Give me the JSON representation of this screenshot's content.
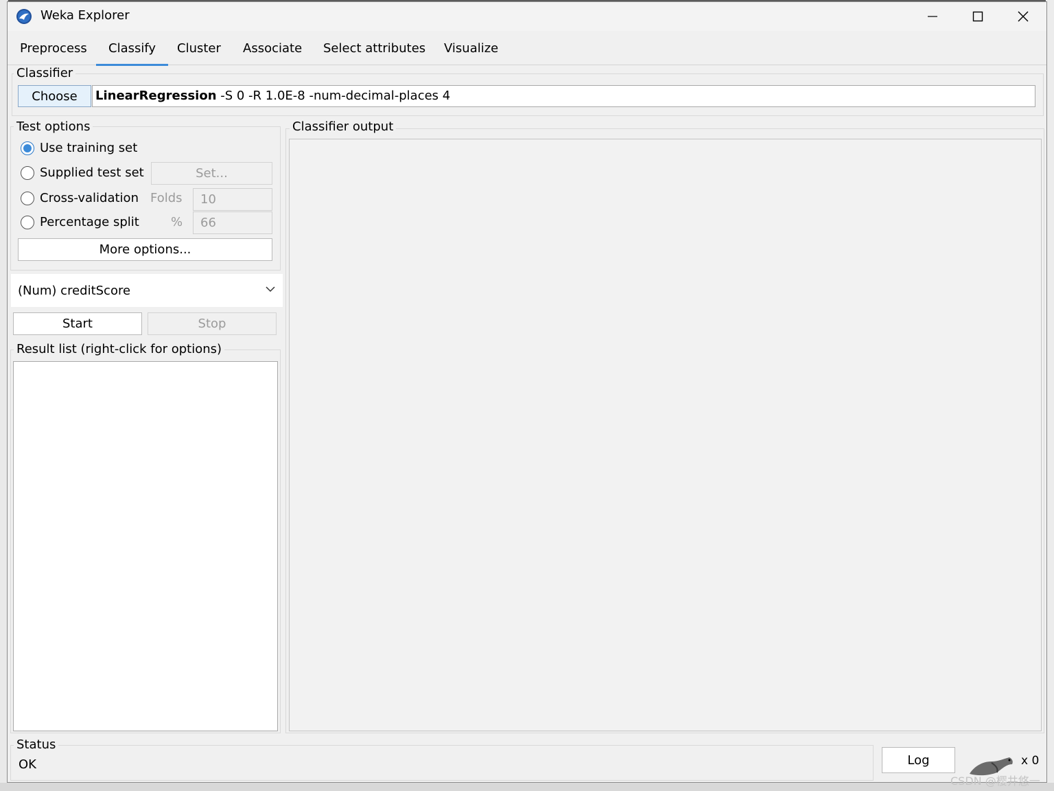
{
  "window": {
    "title": "Weka Explorer"
  },
  "tabs": [
    {
      "label": "Preprocess",
      "active": false
    },
    {
      "label": "Classify",
      "active": true
    },
    {
      "label": "Cluster",
      "active": false
    },
    {
      "label": "Associate",
      "active": false
    },
    {
      "label": "Select attributes",
      "active": false
    },
    {
      "label": "Visualize",
      "active": false
    }
  ],
  "classifier": {
    "legend": "Classifier",
    "choose_label": "Choose",
    "name": "LinearRegression",
    "options": " -S 0 -R 1.0E-8 -num-decimal-places 4"
  },
  "test_options": {
    "legend": "Test options",
    "use_training_set": "Use training set",
    "supplied_test_set": "Supplied test set",
    "set_button": "Set...",
    "cross_validation": "Cross-validation",
    "folds_label": "Folds",
    "folds_value": "10",
    "percentage_split": "Percentage split",
    "percent_label": "%",
    "percent_value": "66",
    "more_options": "More options...",
    "selected": "use_training_set"
  },
  "class_attribute": {
    "selected": "(Num) creditScore"
  },
  "actions": {
    "start": "Start",
    "stop": "Stop"
  },
  "result_list": {
    "legend": "Result list (right-click for options)"
  },
  "output": {
    "legend": "Classifier output"
  },
  "status": {
    "legend": "Status",
    "text": "OK",
    "log_button": "Log",
    "x_count": "x 0"
  },
  "watermark": "CSDN @樱井悠一",
  "colors": {
    "accent": "#3c8bd9",
    "window_bg": "#f0f0f0"
  }
}
